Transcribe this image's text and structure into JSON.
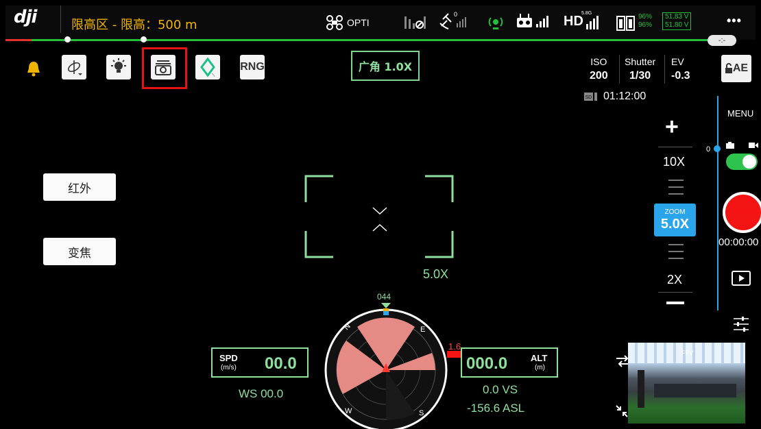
{
  "topbar": {
    "logo": "dji",
    "zone_text": "限高区 - 限高：500 m",
    "craft_label": "OPTI",
    "gps_count": "0",
    "video_band": "5.8G",
    "video_label": "HD",
    "battery1_pct": "96%",
    "battery2_pct": "96%",
    "voltage1": "51.83 V",
    "voltage2": "51.80 V",
    "more": "•••",
    "line_pill": "-:-"
  },
  "toolbar": {
    "rng_label": "RNG",
    "lens_label": "广角 1.0X"
  },
  "exposure": {
    "iso_label": "ISO",
    "iso_value": "200",
    "shutter_label": "Shutter",
    "shutter_value": "1/30",
    "ev_label": "EV",
    "ev_value": "-0.3",
    "storage_time": "01:12:00",
    "ae_label": "AE"
  },
  "side_buttons": {
    "infrared": "红外",
    "zoom": "变焦"
  },
  "reticle": {
    "zoom_label": "5.0X"
  },
  "zoom_panel": {
    "top_label": "10X",
    "badge_title": "ZOOM",
    "badge_value": "5.0X",
    "bottom_label": "2X"
  },
  "right_panel": {
    "menu_label": "MENU",
    "slider_zero": "0",
    "record_time": "00:00:00",
    "recording": true
  },
  "compass": {
    "heading": "044",
    "obstacle_dist": "1.6",
    "letters": [
      "N",
      "E",
      "S",
      "W"
    ]
  },
  "telemetry": {
    "spd_label": "SPD",
    "spd_unit": "(m/s)",
    "spd_value": "00.0",
    "ws_text": "WS 00.0",
    "alt_label": "ALT",
    "alt_unit": "(m)",
    "alt_value": "000.0",
    "vs_text": "0.0  VS",
    "asl_text": "-156.6 ASL"
  },
  "fpv": {
    "label": "FPV"
  },
  "colors": {
    "accent_blue": "#2aa4ea",
    "hud_green": "#8fe09c",
    "warning_orange": "#f0b400",
    "record_red": "#f41414",
    "highlight_red": "#e61313",
    "status_green": "#23c13a"
  }
}
